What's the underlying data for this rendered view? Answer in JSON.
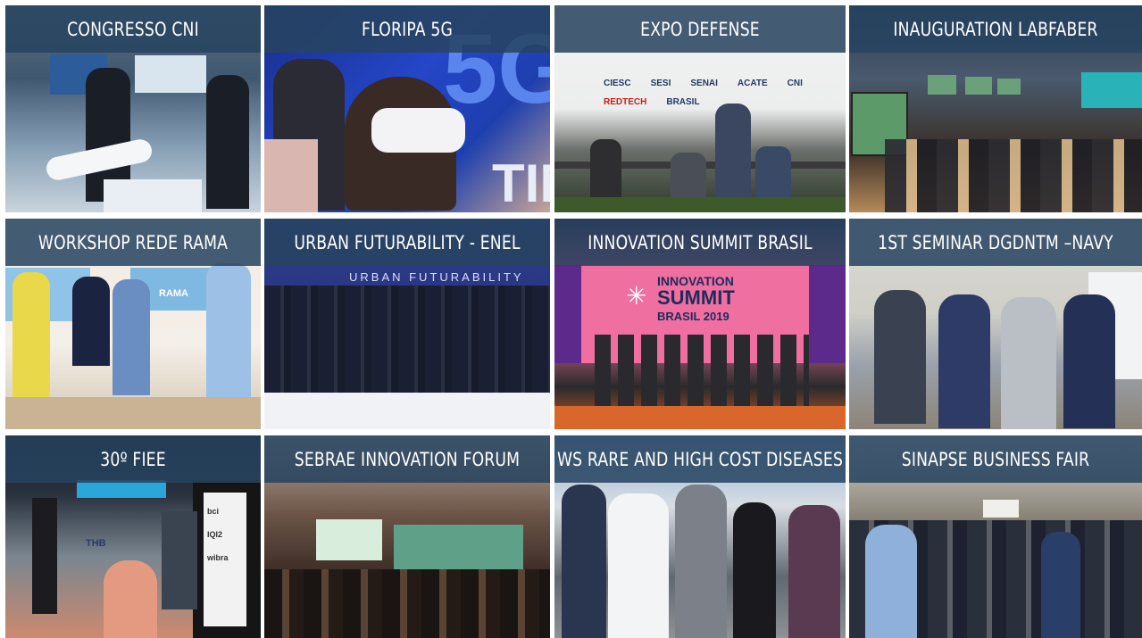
{
  "tiles": [
    {
      "caption": "CONGRESSO CNI",
      "scene": "congress-photo"
    },
    {
      "caption": "FLORIPA 5G",
      "scene": "vr-headset-photo"
    },
    {
      "caption": "EXPO DEFENSE",
      "scene": "panel-stage-photo"
    },
    {
      "caption": "INAUGURATION LABFABER",
      "scene": "auditorium-photo"
    },
    {
      "caption": "WORKSHOP REDE RAMA",
      "scene": "workshop-group-photo"
    },
    {
      "caption": "URBAN FUTURABILITY - ENEL",
      "scene": "group-photo"
    },
    {
      "caption": "INNOVATION SUMMIT BRASIL",
      "scene": "summit-stage-photo"
    },
    {
      "caption": "1ST SEMINAR DGDNTM –NAVY",
      "scene": "seminar-panel-photo"
    },
    {
      "caption": "30º FIEE",
      "scene": "fair-booth-photo"
    },
    {
      "caption": "SEBRAE INNOVATION FORUM",
      "scene": "forum-audience-photo"
    },
    {
      "caption": "WS RARE AND HIGH COST DISEASES",
      "scene": "outdoor-group-photo"
    },
    {
      "caption": "SINAPSE BUSINESS FAIR",
      "scene": "business-fair-photo"
    }
  ],
  "photo_text": {
    "floripa_5g": "5G",
    "floripa_tim": "TIM",
    "urban_banner": "URBAN FUTURABILITY",
    "summit_line1": "INNOVATION",
    "summit_line2": "SUMMIT",
    "summit_line3": "BRASIL 2019",
    "expo_logos": [
      "CIESC",
      "SESI",
      "SENAI",
      "ACATE",
      "CNI",
      "REDTECH",
      "BRASIL"
    ],
    "rama_sign": "RAMA",
    "fiee_brands": [
      "THB",
      "bci",
      "IQI2",
      "wibra"
    ]
  },
  "colors": {
    "caption_bg": "#26445f",
    "caption_text": "#ffffff",
    "summit_pink": "#e96d9a"
  }
}
